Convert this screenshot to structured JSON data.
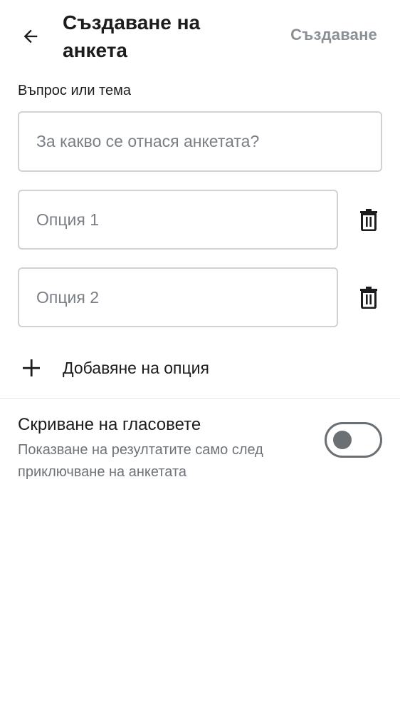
{
  "header": {
    "title": "Създаване на анкета",
    "create_label": "Създаване",
    "back_icon": "arrow-left-icon"
  },
  "question": {
    "label": "Въпрос или тема",
    "placeholder": "За какво се отнася анкетата?",
    "value": ""
  },
  "options": [
    {
      "placeholder": "Опция 1",
      "value": "",
      "delete_icon": "trash-icon"
    },
    {
      "placeholder": "Опция 2",
      "value": "",
      "delete_icon": "trash-icon"
    }
  ],
  "add_option": {
    "label": "Добавяне на опция",
    "icon": "plus-icon"
  },
  "hide_votes": {
    "title": "Скриване на гласовете",
    "description": "Показване на резултатите само след приключване на анкетата",
    "enabled": false
  },
  "colors": {
    "text": "#1c1c1e",
    "secondary_text": "#6e737a",
    "disabled_action": "#8a9096",
    "border": "#cfd2d6",
    "toggle_off": "#6b7075"
  }
}
